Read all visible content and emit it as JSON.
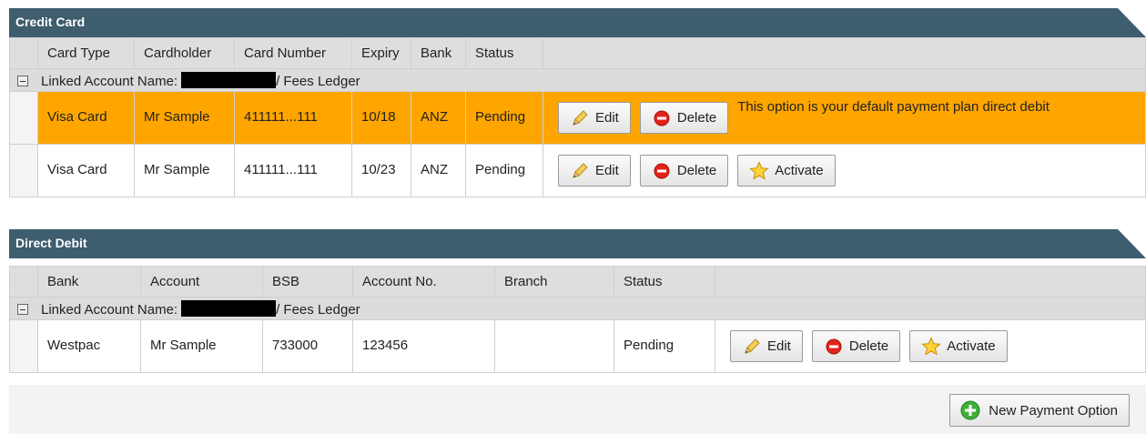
{
  "credit_card": {
    "title": "Credit Card",
    "columns": [
      "Card Type",
      "Cardholder",
      "Card Number",
      "Expiry",
      "Bank",
      "Status"
    ],
    "group_label": "Linked Account Name:",
    "group_suffix": "/ Fees Ledger",
    "rows": [
      {
        "card_type": "Visa Card",
        "cardholder": "Mr Sample",
        "card_number": "411111...111",
        "expiry": "10/18",
        "bank": "ANZ",
        "status": "Pending",
        "edit": "Edit",
        "delete": "Delete",
        "note": "This option is your default payment plan direct debit"
      },
      {
        "card_type": "Visa Card",
        "cardholder": "Mr Sample",
        "card_number": "411111...111",
        "expiry": "10/23",
        "bank": "ANZ",
        "status": "Pending",
        "edit": "Edit",
        "delete": "Delete",
        "activate": "Activate"
      }
    ]
  },
  "direct_debit": {
    "title": "Direct Debit",
    "columns": [
      "Bank",
      "Account",
      "BSB",
      "Account No.",
      "Branch",
      "Status"
    ],
    "group_label": "Linked Account Name:",
    "group_suffix": "/ Fees Ledger",
    "rows": [
      {
        "bank": "Westpac",
        "account": "Mr Sample",
        "bsb": "733000",
        "account_no": "123456",
        "branch": "",
        "status": "Pending",
        "edit": "Edit",
        "delete": "Delete",
        "activate": "Activate"
      }
    ]
  },
  "footer": {
    "new_option": "New Payment Option"
  },
  "colors": {
    "header": "#3e5d6e",
    "highlight": "#ffa500",
    "grid_header": "#dedede"
  },
  "icons": [
    "pencil-icon",
    "delete-icon",
    "star-icon",
    "plus-icon",
    "collapse-icon"
  ]
}
